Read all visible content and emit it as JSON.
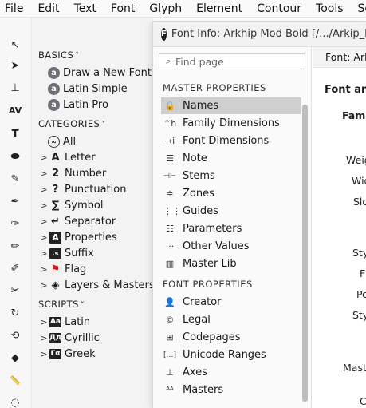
{
  "menubar": [
    "File",
    "Edit",
    "Text",
    "Font",
    "Glyph",
    "Element",
    "Contour",
    "Tools",
    "Scripts"
  ],
  "tools": [
    {
      "name": "pointer-tool-icon",
      "glyph": "↖"
    },
    {
      "name": "select-tool-icon",
      "glyph": "➤"
    },
    {
      "name": "measure-tool-icon",
      "glyph": "⊥"
    },
    {
      "name": "kerning-tool-icon",
      "glyph": "AV"
    },
    {
      "name": "text-tool-icon",
      "glyph": "T"
    },
    {
      "name": "eraser-tool-icon",
      "glyph": "⬬"
    },
    {
      "name": "brush-tool-icon",
      "glyph": "✎"
    },
    {
      "name": "pen-tool-icon",
      "glyph": "✒"
    },
    {
      "name": "pen-alt-tool-icon",
      "glyph": "✑"
    },
    {
      "name": "pencil-tool-icon",
      "glyph": "✏"
    },
    {
      "name": "calligraphy-tool-icon",
      "glyph": "✐"
    },
    {
      "name": "knife-tool-icon",
      "glyph": "✂"
    },
    {
      "name": "rotate-tool-icon",
      "glyph": "↻"
    },
    {
      "name": "transform-tool-icon",
      "glyph": "⟲"
    },
    {
      "name": "fill-tool-icon",
      "glyph": "◆"
    },
    {
      "name": "ruler-tool-icon",
      "glyph": "📏"
    },
    {
      "name": "lasso-tool-icon",
      "glyph": "◌"
    }
  ],
  "sidebar": {
    "basics_title": "BASICS",
    "basics": [
      {
        "label": "Draw a New Font",
        "icon": "a"
      },
      {
        "label": "Latin Simple",
        "icon": "a"
      },
      {
        "label": "Latin Pro",
        "icon": "a"
      }
    ],
    "categories_title": "CATEGORIES",
    "all_label": "All",
    "categories": [
      {
        "label": "Letter",
        "icon": "A"
      },
      {
        "label": "Number",
        "icon": "2"
      },
      {
        "label": "Punctuation",
        "icon": "?"
      },
      {
        "label": "Symbol",
        "icon": "∑"
      },
      {
        "label": "Separator",
        "icon": "↵"
      },
      {
        "label": "Properties",
        "icon": "A"
      },
      {
        "label": "Suffix",
        "icon": ".s"
      },
      {
        "label": "Flag",
        "icon": "⚑"
      },
      {
        "label": "Layers & Masters",
        "icon": "◈"
      }
    ],
    "scripts_title": "SCRIPTS",
    "scripts": [
      {
        "label": "Latin",
        "icon": "Aa"
      },
      {
        "label": "Cyrillic",
        "icon": "Дд"
      },
      {
        "label": "Greek",
        "icon": "Γα"
      }
    ]
  },
  "window": {
    "title": "Font Info: Arkhip Mod Bold [/.../Arkip_M",
    "search_placeholder": "Find page",
    "master_heading": "MASTER PROPERTIES",
    "master_items": [
      {
        "label": "Names",
        "icon": "🔒"
      },
      {
        "label": "Family Dimensions",
        "icon": "↑h"
      },
      {
        "label": "Font Dimensions",
        "icon": "→i"
      },
      {
        "label": "Note",
        "icon": "☰"
      },
      {
        "label": "Stems",
        "icon": "⊣⊢"
      },
      {
        "label": "Zones",
        "icon": "≑"
      },
      {
        "label": "Guides",
        "icon": "⋮⋮"
      },
      {
        "label": "Parameters",
        "icon": "☷"
      },
      {
        "label": "Other Values",
        "icon": "···"
      },
      {
        "label": "Master Lib",
        "icon": "▥"
      }
    ],
    "font_heading": "FONT PROPERTIES",
    "font_items": [
      {
        "label": "Creator",
        "icon": "👤"
      },
      {
        "label": "Legal",
        "icon": "©"
      },
      {
        "label": "Codepages",
        "icon": "⊞"
      },
      {
        "label": "Unicode Ranges",
        "icon": "[…]"
      },
      {
        "label": "Axes",
        "icon": "⊥"
      },
      {
        "label": "Masters",
        "icon": "ᴬᴬ"
      }
    ],
    "right_header": "Font: Ark",
    "right_section": "Font and",
    "right_labels": [
      "Famil",
      "Weig",
      "Wid",
      "Slo",
      "Sty",
      "F",
      "Po",
      "Sty",
      "Mast",
      "C"
    ]
  }
}
